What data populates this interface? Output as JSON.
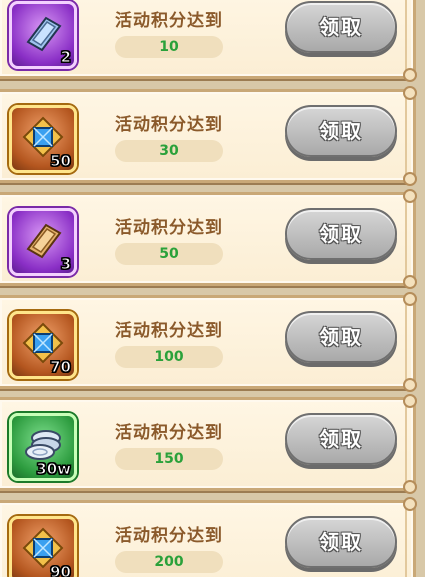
{
  "rows": [
    {
      "item": "silver-ingot-icon",
      "frame": "purple",
      "count": "2",
      "label": "活动积分达到",
      "points": "10",
      "button": "领取"
    },
    {
      "item": "gold-gem-shield-icon",
      "frame": "gold",
      "count": "50",
      "label": "活动积分达到",
      "points": "30",
      "button": "领取"
    },
    {
      "item": "gold-ingot-icon",
      "frame": "purple",
      "count": "3",
      "label": "活动积分达到",
      "points": "50",
      "button": "领取"
    },
    {
      "item": "gold-gem-shield-icon",
      "frame": "gold",
      "count": "70",
      "label": "活动积分达到",
      "points": "100",
      "button": "领取"
    },
    {
      "item": "silver-coins-icon",
      "frame": "green",
      "count": "30w",
      "label": "活动积分达到",
      "points": "150",
      "button": "领取"
    },
    {
      "item": "gold-gem-shield-icon",
      "frame": "gold",
      "count": "90",
      "label": "活动积分达到",
      "points": "200",
      "button": "领取"
    }
  ],
  "colors": {
    "points_text": "#2aa13a",
    "label_text": "#8b5a2b",
    "button_disabled": "#b5b5b5"
  }
}
